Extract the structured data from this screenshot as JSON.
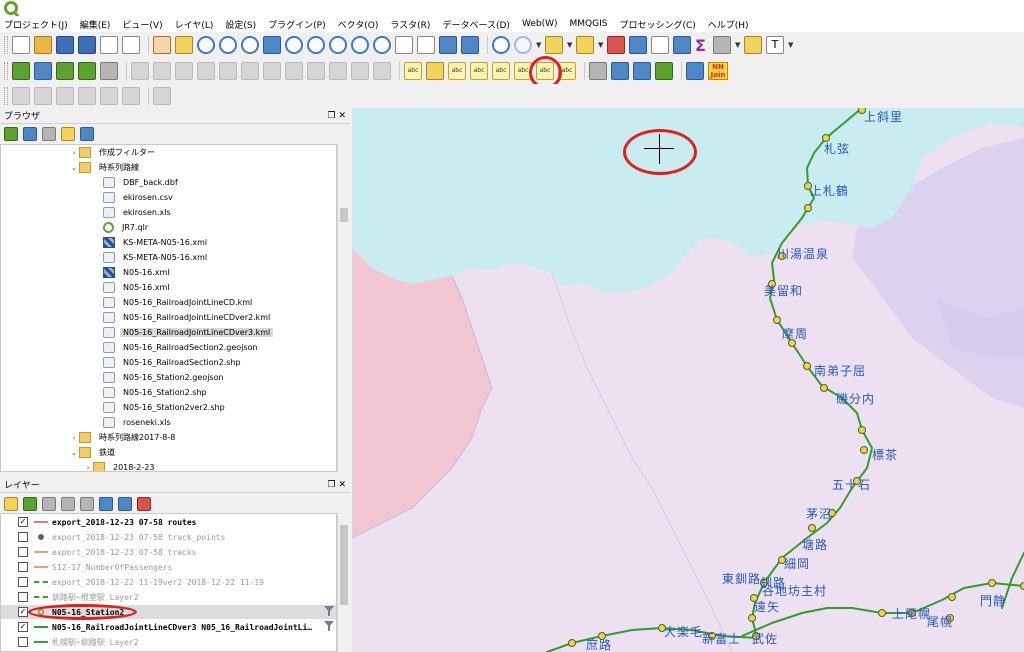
{
  "menu": [
    "プロジェクト(J)",
    "編集(E)",
    "ビュー(V)",
    "レイヤ(L)",
    "設定(S)",
    "プラグイン(P)",
    "ベクタ(O)",
    "ラスタ(R)",
    "データベース(D)",
    "Web(W)",
    "MMQGIS",
    "プロセッシング(C)",
    "ヘルプ(H)"
  ],
  "toolbar": {
    "nnjoin_top": "NN",
    "nnjoin_bottom": "Join",
    "text_annotation": "T"
  },
  "browser": {
    "title": "ブラウザ",
    "items": [
      {
        "name": "作成フィルター",
        "type": "folder",
        "arrow": "›"
      },
      {
        "name": "時系列路線",
        "type": "folder",
        "arrow": "⌄"
      },
      {
        "name": "DBF_back.dbf",
        "type": "file",
        "arrow": ""
      },
      {
        "name": "ekirosen.csv",
        "type": "file",
        "arrow": ""
      },
      {
        "name": "ekirosen.xls",
        "type": "file",
        "arrow": ""
      },
      {
        "name": "JR7.qlr",
        "type": "qgis",
        "arrow": ""
      },
      {
        "name": "KS-META-N05-16.xml",
        "type": "raster",
        "arrow": ""
      },
      {
        "name": "KS-META-N05-16.xml",
        "type": "file",
        "arrow": ""
      },
      {
        "name": "N05-16.xml",
        "type": "raster",
        "arrow": ""
      },
      {
        "name": "N05-16.xml",
        "type": "file",
        "arrow": ""
      },
      {
        "name": "N05-16_RailroadJointLineCD.kml",
        "type": "file",
        "arrow": ""
      },
      {
        "name": "N05-16_RailroadJointLineCDver2.kml",
        "type": "file",
        "arrow": ""
      },
      {
        "name": "N05-16_RailroadJointLineCDver3.kml",
        "type": "file",
        "arrow": "",
        "selected": true
      },
      {
        "name": "N05-16_RailroadSection2.geojson",
        "type": "file",
        "arrow": ""
      },
      {
        "name": "N05-16_RailroadSection2.shp",
        "type": "file",
        "arrow": ""
      },
      {
        "name": "N05-16_Station2.geojson",
        "type": "file",
        "arrow": ""
      },
      {
        "name": "N05-16_Station2.shp",
        "type": "file",
        "arrow": ""
      },
      {
        "name": "N05-16_Station2ver2.shp",
        "type": "file",
        "arrow": ""
      },
      {
        "name": "roseneki.xls",
        "type": "file",
        "arrow": ""
      },
      {
        "name": "時系列路線2017-8-8",
        "type": "folder",
        "arrow": "›"
      },
      {
        "name": "鉄道",
        "type": "folder",
        "arrow": "⌄"
      },
      {
        "name": "2018-2-23",
        "type": "folder",
        "arrow": "›"
      }
    ]
  },
  "layers": {
    "title": "レイヤー",
    "items": [
      {
        "name": "export_2018-12-23 07-58 routes",
        "checked": true,
        "style": "bold",
        "sym": "line",
        "color": "#e07a7a"
      },
      {
        "name": "export_2018-12-23 07-58 track_points",
        "checked": false,
        "style": "off",
        "sym": "pt",
        "color": "#3d7a3d"
      },
      {
        "name": "export_2018-12-23 07-58 tracks",
        "checked": false,
        "style": "off",
        "sym": "line",
        "color": "#e6a36a"
      },
      {
        "name": "S12-17_NumberOfPassengers",
        "checked": false,
        "style": "off",
        "sym": "line",
        "color": "#e6a36a"
      },
      {
        "name": "export_2018-12-22 11-19ver2 2018-12-22 11-19",
        "checked": false,
        "style": "off",
        "sym": "dash",
        "color": "#3aa03a"
      },
      {
        "name": "釧路駅~根室駅 Layer2",
        "checked": false,
        "style": "off",
        "sym": "dash",
        "color": "#3aa03a"
      },
      {
        "name": "N05-16_Station2",
        "checked": true,
        "style": "bold",
        "sym": "pt",
        "color": "#e6d84a",
        "selected": true,
        "filter": true
      },
      {
        "name": "N05-16_RailroadJointLineCDver3 N05_16_RailroadJointLi…",
        "checked": true,
        "style": "bold",
        "sym": "line",
        "color": "#2e9e2e",
        "filter": true
      },
      {
        "name": "札幌駅~釧路駅 Layer2",
        "checked": false,
        "style": "off",
        "sym": "line",
        "color": "#3aa03a"
      }
    ]
  },
  "map": {
    "stations": [
      "上斜里",
      "札弦",
      "上札鶴",
      "川湯温泉",
      "美留和",
      "摩周",
      "南弟子屈",
      "磯分内",
      "標茶",
      "五十石",
      "茅沼",
      "塘路",
      "細岡",
      "釧路",
      "東釧路",
      "遠矢",
      "上尾幌",
      "尾幌",
      "門静",
      "大楽毛",
      "新富士",
      "武佐",
      "庶路",
      "谷地坊主村"
    ],
    "colors": {
      "sea": "#c8ecef",
      "land": "#ece0f1",
      "lilac": "#dcd2f0",
      "pink": "#f2c6d3",
      "line": "#2e9e2e",
      "station": "#e6d84a",
      "label": "#2559b5",
      "annotation": "#e01f1f"
    }
  }
}
